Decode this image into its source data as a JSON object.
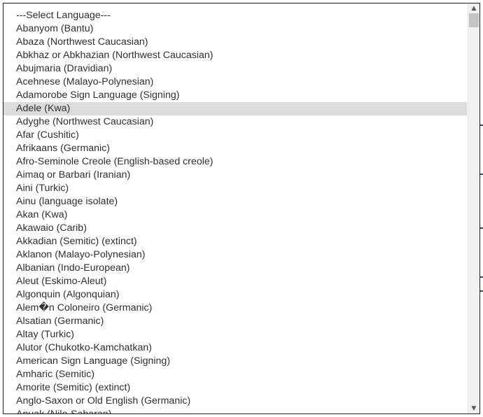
{
  "language_select": {
    "options": [
      "---Select Language---",
      "Abanyom (Bantu)",
      "Abaza (Northwest Caucasian)",
      "Abkhaz or Abkhazian (Northwest Caucasian)",
      "Abujmaria (Dravidian)",
      "Acehnese (Malayo-Polynesian)",
      "Adamorobe Sign Language (Signing)",
      "Adele (Kwa)",
      "Adyghe (Northwest Caucasian)",
      "Afar (Cushitic)",
      "Afrikaans (Germanic)",
      "Afro-Seminole Creole (English-based creole)",
      "Aimaq or Barbari (Iranian)",
      "Aini (Turkic)",
      "Ainu (language isolate)",
      "Akan (Kwa)",
      "Akawaio (Carib)",
      "Akkadian (Semitic) (extinct)",
      "Aklanon (Malayo-Polynesian)",
      "Albanian (Indo-European)",
      "Aleut (Eskimo-Aleut)",
      "Algonquin (Algonquian)",
      "Alem�n Coloneiro (Germanic)",
      "Alsatian (Germanic)",
      "Altay (Turkic)",
      "Alutor (Chukotko-Kamchatkan)",
      "American Sign Language (Signing)",
      "Amharic (Semitic)",
      "Amorite (Semitic) (extinct)",
      "Anglo-Saxon or Old English (Germanic)",
      "Anuak (Nilo-Saharan)"
    ],
    "highlighted_option": "Adele (Kwa)",
    "scroll_position": 0.0
  },
  "icons": {
    "scroll_up": "triangle-up-icon",
    "scroll_down": "triangle-down-icon"
  },
  "colors": {
    "highlight": "#dcdcdc",
    "text": "#2f2f2f",
    "border": "#1f1f1f"
  }
}
